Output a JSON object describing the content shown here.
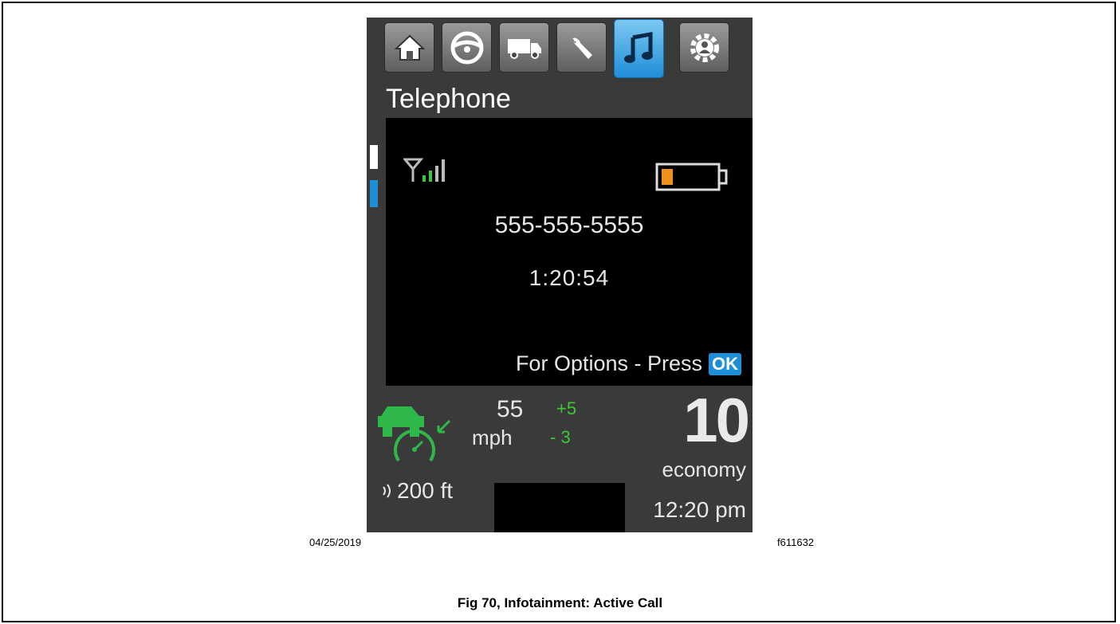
{
  "screen": {
    "title": "Telephone",
    "tabs": [
      {
        "icon": "home-icon",
        "active": false
      },
      {
        "icon": "steering-wheel-icon",
        "active": false
      },
      {
        "icon": "truck-icon",
        "active": false
      },
      {
        "icon": "wrench-icon",
        "active": false
      },
      {
        "icon": "music-note-icon",
        "active": true
      },
      {
        "icon": "settings-gear-icon",
        "active": false
      }
    ]
  },
  "call": {
    "phone_number": "555-555-5555",
    "duration": "1:20:54",
    "options_text": "For Options - Press",
    "ok_label": "OK",
    "signal_icon": "signal-strength-icon",
    "battery_icon": "battery-low-icon"
  },
  "status": {
    "set_speed": "55",
    "speed_unit": "mph",
    "delta_plus": "+5",
    "delta_minus": "- 3",
    "big_value": "10",
    "economy_label": "economy",
    "time": "12:20 pm",
    "distance": "200 ft"
  },
  "captions": {
    "date": "04/25/2019",
    "figure_id": "f611632",
    "figure_title": "Fig 70,  Infotainment: Active Call"
  },
  "colors": {
    "accent_blue": "#1f8ed8",
    "green": "#3cc83c",
    "battery_orange": "#f0901a"
  }
}
